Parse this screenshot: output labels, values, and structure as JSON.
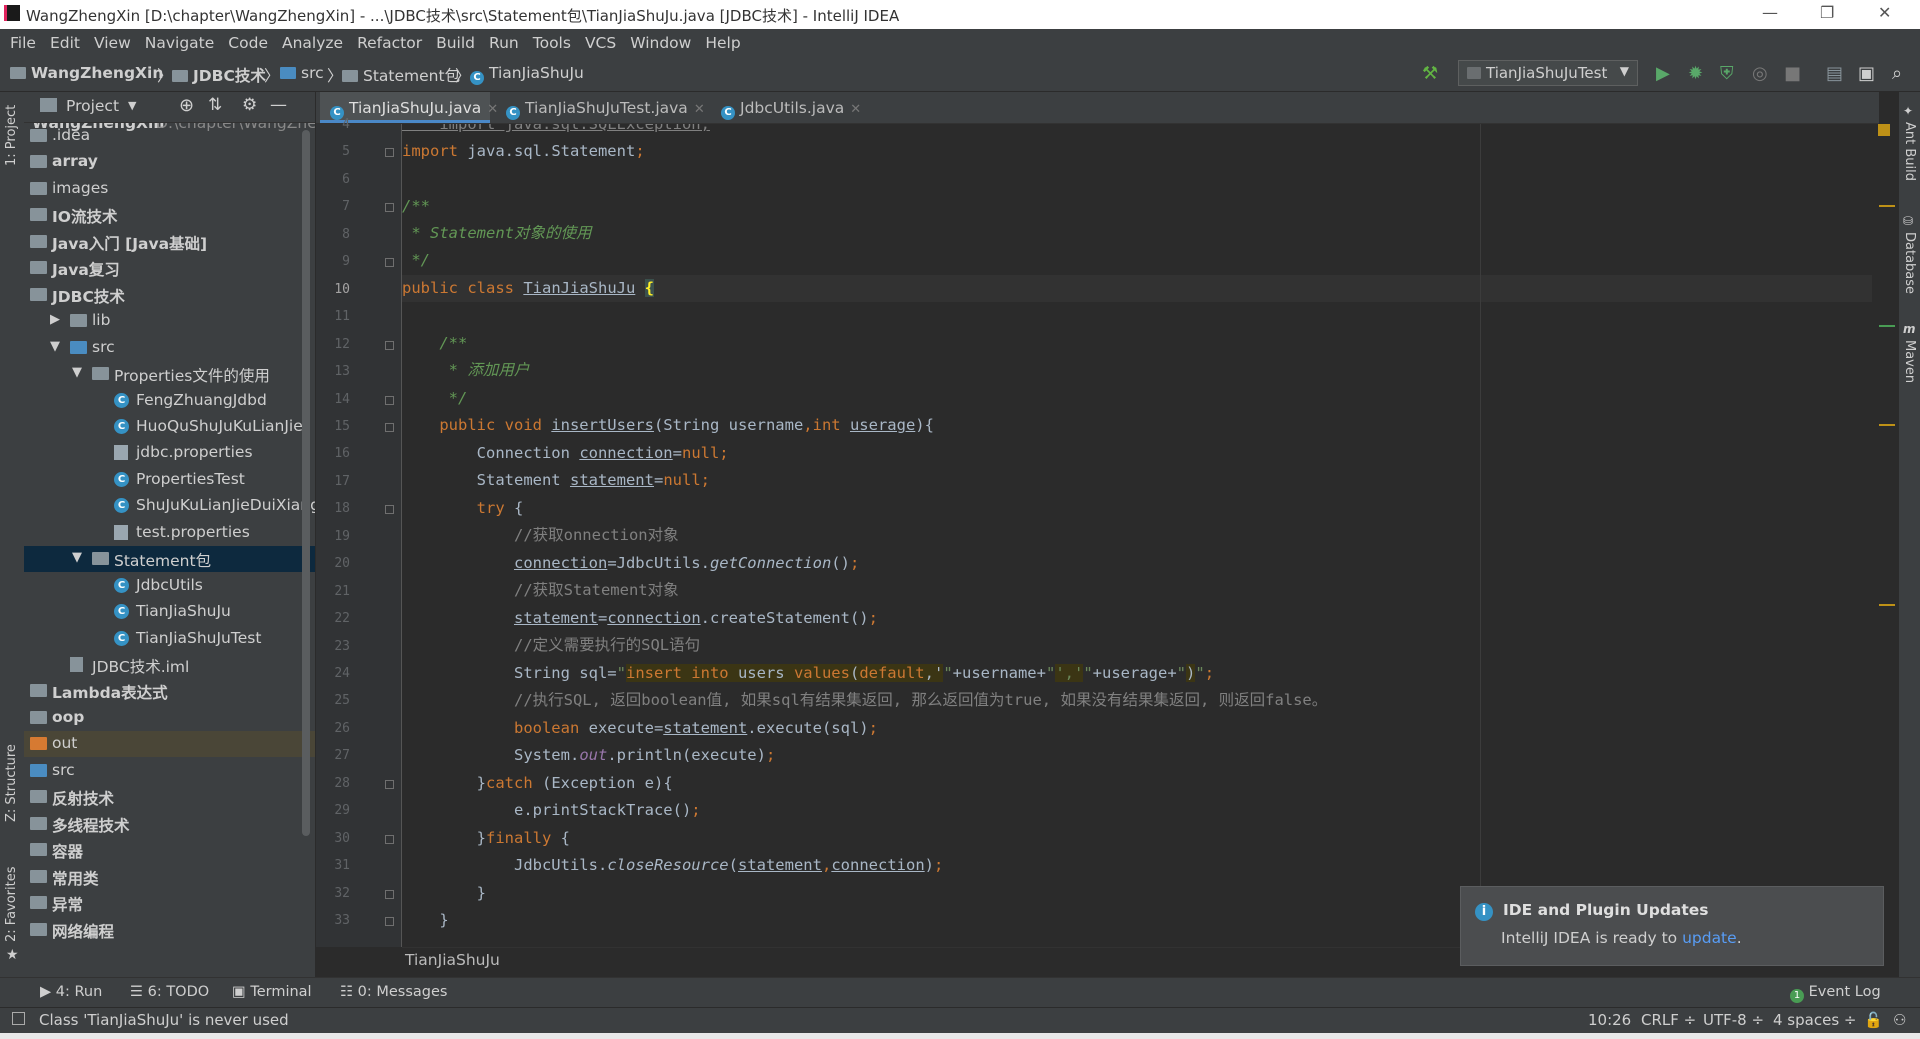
{
  "window": {
    "title": "WangZhengXin [D:\\chapter\\WangZhengXin] - ...\\JDBC技术\\src\\Statement包\\TianJiaShuJu.java [JDBC技术] - IntelliJ IDEA"
  },
  "menu": [
    "File",
    "Edit",
    "View",
    "Navigate",
    "Code",
    "Analyze",
    "Refactor",
    "Build",
    "Run",
    "Tools",
    "VCS",
    "Window",
    "Help"
  ],
  "breadcrumb": [
    "WangZhengXin",
    "JDBC技术",
    "src",
    "Statement包",
    "TianJiaShuJu"
  ],
  "run_config": "TianJiaShuJuTest",
  "left_stripe": {
    "project": "1: Project",
    "structure": "Z: Structure",
    "favorites": "2: Favorites"
  },
  "right_stripe": {
    "ant": "Ant Build",
    "database": "Database",
    "maven": "Maven"
  },
  "project_panel": {
    "title": "Project",
    "root_name": "WangZhengXin",
    "root_path": "D:\\chapter\\WangZher",
    "items": [
      {
        "label": ".idea",
        "kind": "folder",
        "bold": false
      },
      {
        "label": "array",
        "kind": "folder",
        "bold": true
      },
      {
        "label": "images",
        "kind": "folder",
        "bold": false
      },
      {
        "label": "IO流技术",
        "kind": "folder",
        "bold": true
      },
      {
        "label": "Java入门 [Java基础]",
        "kind": "folder",
        "bold": true
      },
      {
        "label": "Java复习",
        "kind": "folder",
        "bold": true
      },
      {
        "label": "JDBC技术",
        "kind": "folder",
        "bold": true
      },
      {
        "label": "lib",
        "kind": "folder",
        "bold": false
      },
      {
        "label": "src",
        "kind": "src",
        "bold": false
      },
      {
        "label": "Properties文件的使用",
        "kind": "package",
        "bold": false
      },
      {
        "label": "FengZhuangJdbd",
        "kind": "class",
        "bold": false
      },
      {
        "label": "HuoQuShuJuKuLianJie",
        "kind": "class",
        "bold": false
      },
      {
        "label": "jdbc.properties",
        "kind": "prop",
        "bold": false
      },
      {
        "label": "PropertiesTest",
        "kind": "class",
        "bold": false
      },
      {
        "label": "ShuJuKuLianJieDuiXiang",
        "kind": "class",
        "bold": false
      },
      {
        "label": "test.properties",
        "kind": "prop",
        "bold": false
      },
      {
        "label": "Statement包",
        "kind": "package",
        "bold": false
      },
      {
        "label": "JdbcUtils",
        "kind": "class",
        "bold": false
      },
      {
        "label": "TianJiaShuJu",
        "kind": "class",
        "bold": false
      },
      {
        "label": "TianJiaShuJuTest",
        "kind": "class",
        "bold": false
      },
      {
        "label": "JDBC技术.iml",
        "kind": "iml",
        "bold": false
      },
      {
        "label": "Lambda表达式",
        "kind": "folder",
        "bold": true
      },
      {
        "label": "oop",
        "kind": "folder",
        "bold": true
      },
      {
        "label": "out",
        "kind": "orange",
        "bold": false
      },
      {
        "label": "src",
        "kind": "src",
        "bold": false
      },
      {
        "label": "反射技术",
        "kind": "folder",
        "bold": true
      },
      {
        "label": "多线程技术",
        "kind": "folder",
        "bold": true
      },
      {
        "label": "容器",
        "kind": "folder",
        "bold": true
      },
      {
        "label": "常用类",
        "kind": "folder",
        "bold": true
      },
      {
        "label": "异常",
        "kind": "folder",
        "bold": true
      },
      {
        "label": "网络编程",
        "kind": "folder",
        "bold": true
      }
    ]
  },
  "tabs": [
    {
      "label": "TianJiaShuJu.java",
      "active": true
    },
    {
      "label": "TianJiaShuJuTest.java",
      "active": false
    },
    {
      "label": "JdbcUtils.java",
      "active": false
    }
  ],
  "editor": {
    "line_numbers": [
      "4",
      "5",
      "6",
      "7",
      "8",
      "9",
      "10",
      "11",
      "12",
      "13",
      "14",
      "15",
      "16",
      "17",
      "18",
      "19",
      "20",
      "21",
      "22",
      "23",
      "24",
      "25",
      "26",
      "27",
      "28",
      "29",
      "30",
      "31",
      "32",
      "33"
    ],
    "current_line": "10",
    "breadcrumb_footer": "TianJiaShuJu"
  },
  "notification": {
    "title": "IDE and Plugin Updates",
    "body": "IntelliJ IDEA is ready to ",
    "link": "update",
    "tail": "."
  },
  "bottom_tools": [
    {
      "label": "4: Run",
      "icon": "run-icon"
    },
    {
      "label": "6: TODO",
      "icon": "todo-icon"
    },
    {
      "label": "Terminal",
      "icon": "terminal-icon"
    },
    {
      "label": "0: Messages",
      "icon": "messages-icon"
    }
  ],
  "event_log": "Event Log",
  "status": {
    "message": "Class 'TianJiaShuJu' is never used",
    "position": "10:26",
    "line_sep": "CRLF ÷",
    "encoding": "UTF-8 ÷",
    "indent": "4 spaces ÷"
  },
  "colors": {
    "accent": "#4a88c7",
    "keyword": "#cc7832",
    "string": "#6a8759",
    "comment": "#808080",
    "doc": "#629755"
  }
}
